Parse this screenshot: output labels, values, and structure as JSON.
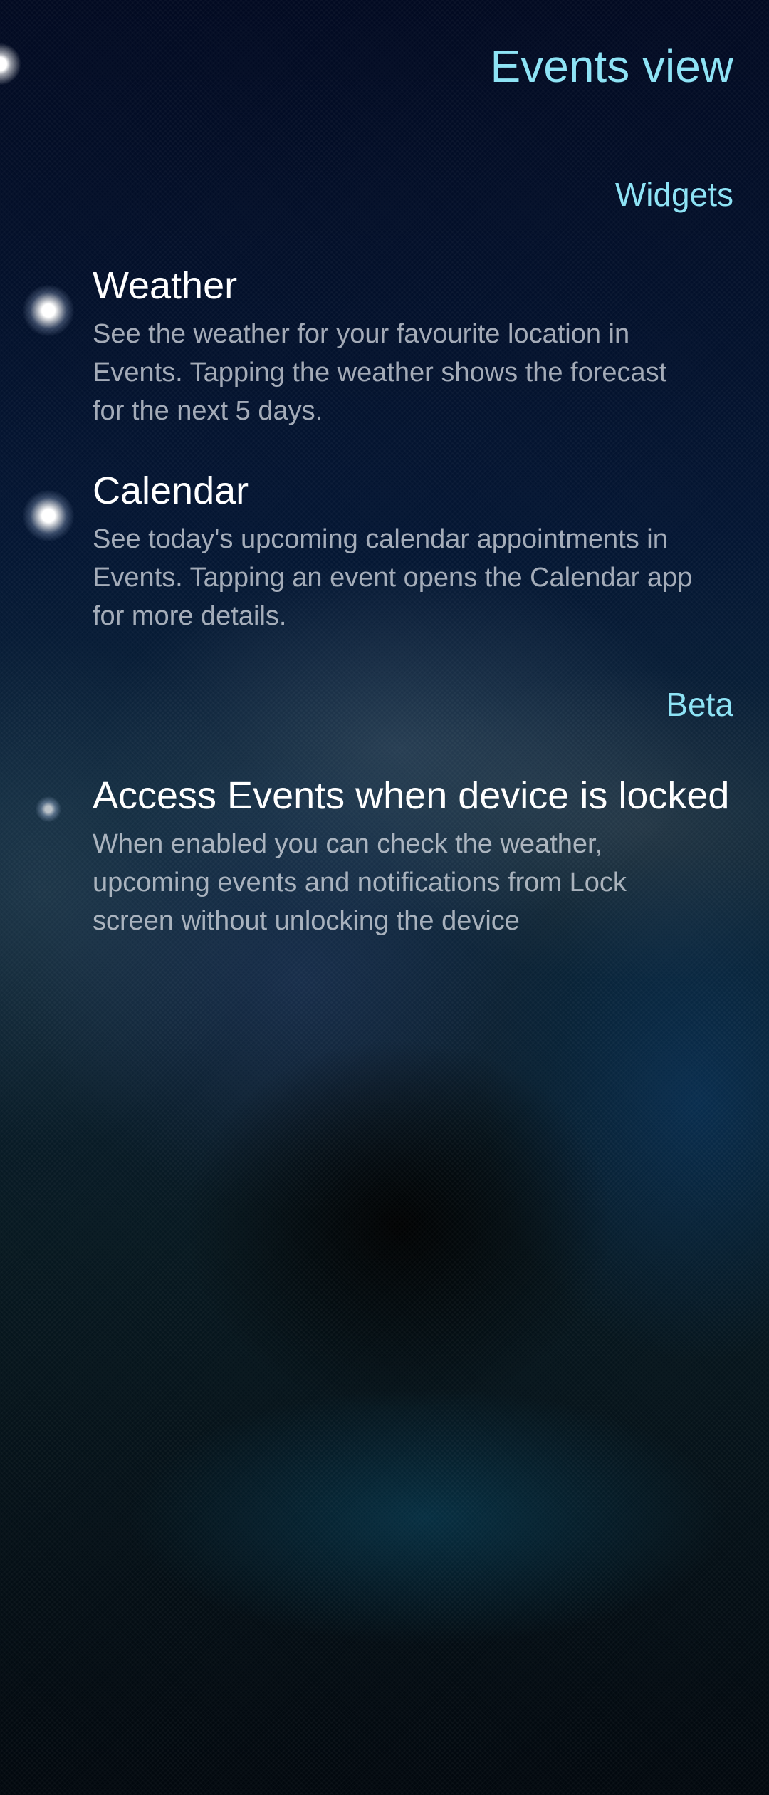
{
  "page": {
    "title": "Events view"
  },
  "sections": {
    "widgets": "Widgets",
    "beta": "Beta"
  },
  "items": [
    {
      "title": "Weather",
      "description": "See the weather for your favourite location in Events. Tapping the weather shows the forecast for the next 5 days.",
      "enabled": true
    },
    {
      "title": "Calendar",
      "description": "See today's upcoming calendar appointments in Events. Tapping an event opens the Calendar app for more details.",
      "enabled": true
    },
    {
      "title": "Access Events when device is locked",
      "description": "When enabled you can check the weather, upcoming events and notifications from Lock screen without unlocking the device",
      "enabled": false
    }
  ],
  "colors": {
    "highlight": "#8ee3f5",
    "primary_text": "#ffffff",
    "secondary_text": "#c9ccd3"
  }
}
